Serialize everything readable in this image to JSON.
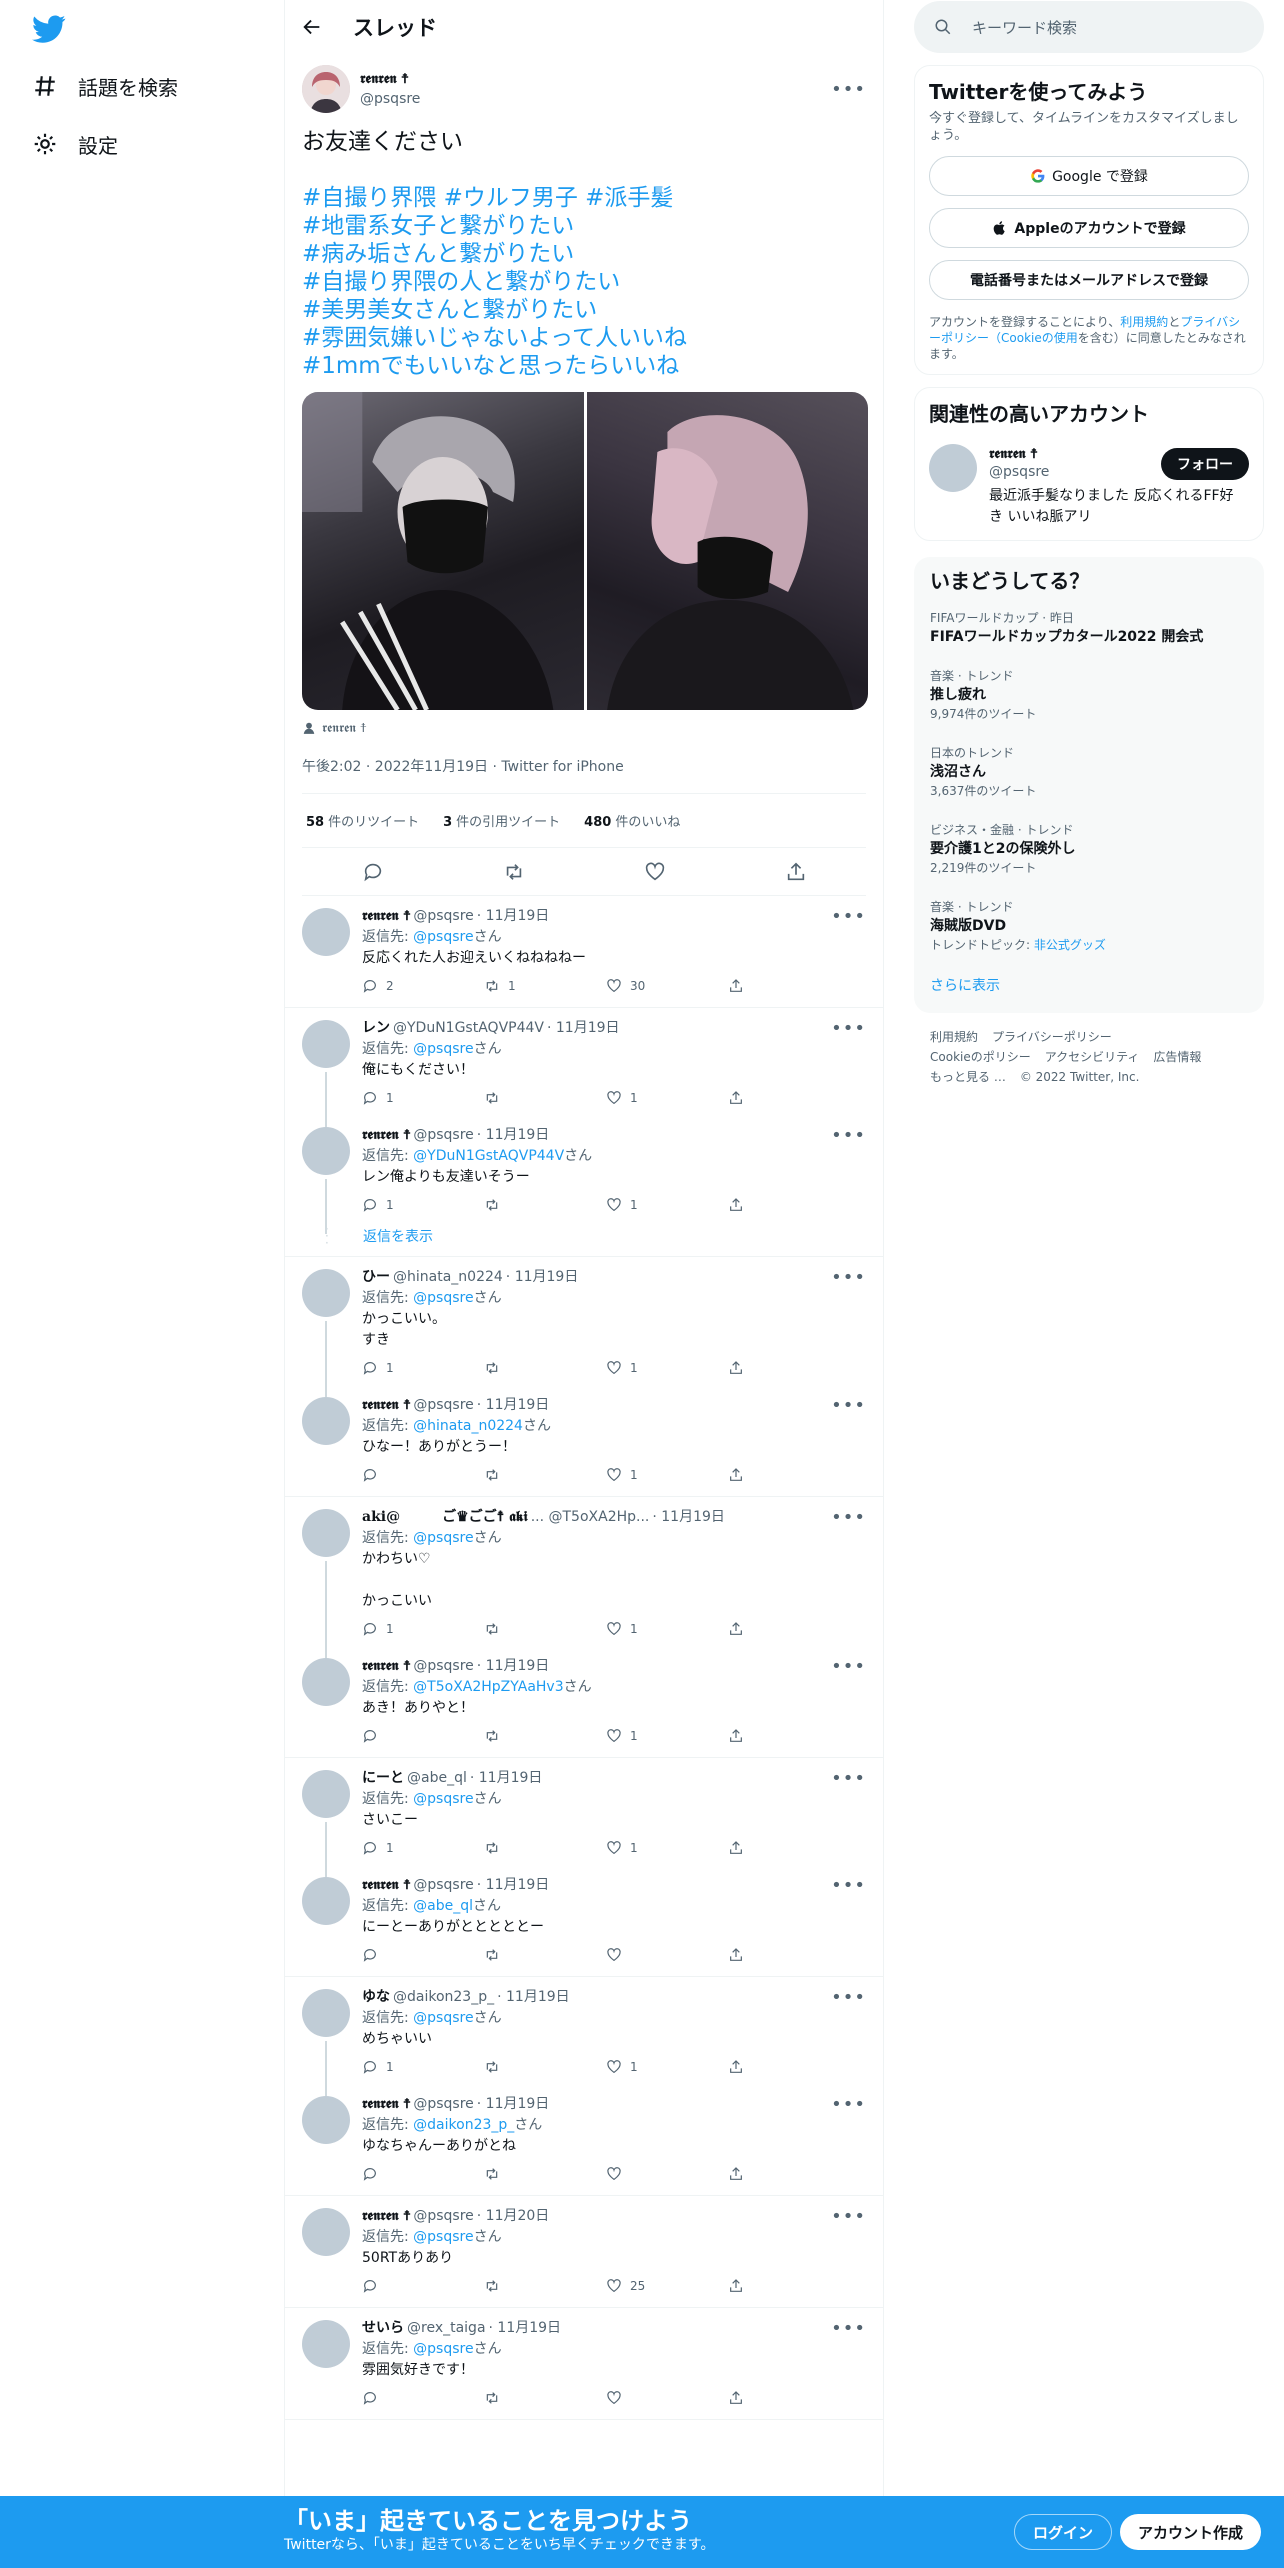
{
  "nav": {
    "explore": "話題を検索",
    "settings": "設定"
  },
  "header": {
    "title": "スレッド"
  },
  "tweet": {
    "name": "𝖗𝖊𝖓𝖗𝖊𝖓 ☨",
    "handle": "@psqsre",
    "text": "お友達ください",
    "hashtags": [
      "#自撮り界隈 #ウルフ男子 #派手髪",
      "#地雷系女子と繋がりたい",
      "#病み垢さんと繋がりたい",
      "#自撮り界隈の人と繋がりたい",
      "#美男美女さんと繋がりたい",
      "#雰囲気嫌いじゃないよって人いいね",
      "#1mmでもいいなと思ったらいいね"
    ],
    "tagged": "𝖗𝖊𝖓𝖗𝖊𝖓 ☨",
    "meta": "午後2:02 · 2022年11月19日 · Twitter for iPhone",
    "retweets": "58",
    "retweets_label": "件のリツイート",
    "quotes": "3",
    "quotes_label": "件の引用ツイート",
    "likes": "480",
    "likes_label": "件のいいね"
  },
  "replyto_label": "返信先: ",
  "san": "さん",
  "show_replies": "返信を表示",
  "conversations": [
    {
      "replies": [
        {
          "name": "𝖗𝖊𝖓𝖗𝖊𝖓 ☨",
          "handle": "@psqsre",
          "date": "· 11月19日",
          "to": "@psqsre",
          "text": "反応くれた人お迎えいくねねねねー",
          "reply": "2",
          "rt": "1",
          "like": "30"
        }
      ]
    },
    {
      "replies": [
        {
          "name": "レン",
          "handle": "@YDuN1GstAQVP44V",
          "date": "· 11月19日",
          "to": "@psqsre",
          "text": "俺にもください！",
          "reply": "1",
          "rt": "",
          "like": "1"
        },
        {
          "name": "𝖗𝖊𝖓𝖗𝖊𝖓 ☨",
          "handle": "@psqsre",
          "date": "· 11月19日",
          "to": "@YDuN1GstAQVP44V",
          "text": "レン俺よりも友達いそうー",
          "reply": "1",
          "rt": "",
          "like": "1"
        }
      ],
      "show_more": true
    },
    {
      "replies": [
        {
          "name": "ひー",
          "handle": "@hinata_n0224",
          "date": "· 11月19日",
          "to": "@psqsre",
          "text": "かっこいい。\nすき",
          "reply": "1",
          "rt": "",
          "like": "1"
        },
        {
          "name": "𝖗𝖊𝖓𝖗𝖊𝖓 ☨",
          "handle": "@psqsre",
          "date": "· 11月19日",
          "to": "@hinata_n0224",
          "text": "ひなー！ありがとうー！",
          "reply": "",
          "rt": "",
          "like": "1"
        }
      ]
    },
    {
      "replies": [
        {
          "name": "aki@　　　ご♛ごご☨ 𝖆𝖐𝖎",
          "handle": "... @T5oXA2Hp...",
          "date": "· 11月19日",
          "to": "@psqsre",
          "text": "かわちい♡\n\nかっこいい",
          "reply": "1",
          "rt": "",
          "like": "1"
        },
        {
          "name": "𝖗𝖊𝖓𝖗𝖊𝖓 ☨",
          "handle": "@psqsre",
          "date": "· 11月19日",
          "to": "@T5oXA2HpZYAaHv3",
          "text": "あき！ありやと！",
          "reply": "",
          "rt": "",
          "like": "1"
        }
      ]
    },
    {
      "replies": [
        {
          "name": "にーと",
          "handle": "@abe_ql",
          "date": "· 11月19日",
          "to": "@psqsre",
          "text": "さいこー",
          "reply": "1",
          "rt": "",
          "like": "1"
        },
        {
          "name": "𝖗𝖊𝖓𝖗𝖊𝖓 ☨",
          "handle": "@psqsre",
          "date": "· 11月19日",
          "to": "@abe_ql",
          "text": "にーとーありがとととととー",
          "reply": "",
          "rt": "",
          "like": ""
        }
      ]
    },
    {
      "replies": [
        {
          "name": "ゆな",
          "handle": "@daikon23_p_",
          "date": "· 11月19日",
          "to": "@psqsre",
          "text": "めちゃいい",
          "reply": "1",
          "rt": "",
          "like": "1"
        },
        {
          "name": "𝖗𝖊𝖓𝖗𝖊𝖓 ☨",
          "handle": "@psqsre",
          "date": "· 11月19日",
          "to": "@daikon23_p_",
          "text": "ゆなちゃんーありがとね",
          "reply": "",
          "rt": "",
          "like": ""
        }
      ]
    },
    {
      "replies": [
        {
          "name": "𝖗𝖊𝖓𝖗𝖊𝖓 ☨",
          "handle": "@psqsre",
          "date": "· 11月20日",
          "to": "@psqsre",
          "text": "50RTありあり",
          "reply": "",
          "rt": "",
          "like": "25"
        }
      ]
    },
    {
      "replies": [
        {
          "name": "せいら",
          "handle": "@rex_taiga",
          "date": "· 11月19日",
          "to": "@psqsre",
          "text": "雰囲気好きです！",
          "reply": "",
          "rt": "",
          "like": ""
        }
      ]
    }
  ],
  "right": {
    "search_placeholder": "キーワード検索",
    "signup": {
      "title": "Twitterを使ってみよう",
      "sub": "今すぐ登録して、タイムラインをカスタマイズしましょう。",
      "google": "Google で登録",
      "apple": "Appleのアカウントで登録",
      "phone": "電話番号またはメールアドレスで登録",
      "terms1": "アカウントを登録することにより、",
      "terms_link1": "利用規約",
      "terms2": "と",
      "terms_link2": "プライバシーポリシー（Cookieの使用",
      "terms3": "を含む）に同意したとみなされます。"
    },
    "related": {
      "title": "関連性の高いアカウント",
      "name": "𝖗𝖊𝖓𝖗𝖊𝖓 ☨",
      "handle": "@psqsre",
      "follow": "フォロー",
      "bio": "最近派手髪なりました 反応くれるFF好き いいね脈アリ"
    },
    "trends": {
      "title": "いまどうしてる？",
      "items": [
        {
          "ctx": "FIFAワールドカップ · 昨日",
          "name": "FIFAワールドカップカタール2022 開会式",
          "count": ""
        },
        {
          "ctx": "音楽 · トレンド",
          "name": "推し疲れ",
          "count": "9,974件のツイート"
        },
        {
          "ctx": "日本のトレンド",
          "name": "浅沼さん",
          "count": "3,637件のツイート"
        },
        {
          "ctx": "ビジネス・金融 · トレンド",
          "name": "要介護1と2の保険外し",
          "count": "2,219件のツイート"
        },
        {
          "ctx": "音楽 · トレンド",
          "name": "海賊版DVD",
          "count": "トレンドトピック: ",
          "link": "非公式グッズ"
        }
      ],
      "more": "さらに表示"
    },
    "footer": {
      "l1": "利用規約",
      "l2": "プライバシーポリシー",
      "l3": "Cookieのポリシー",
      "l4": "アクセシビリティ",
      "l5": "広告情報",
      "l6": "もっと見る …",
      "copy": "© 2022 Twitter, Inc."
    }
  },
  "bottom": {
    "title": "「いま」起きていることを見つけよう",
    "sub": "Twitterなら、「いま」起きていることをいち早くチェックできます。",
    "login": "ログイン",
    "signup": "アカウント作成"
  },
  "colors": {
    "accent": "#1d9bf0",
    "text": "#0f1419",
    "muted": "#536471"
  }
}
